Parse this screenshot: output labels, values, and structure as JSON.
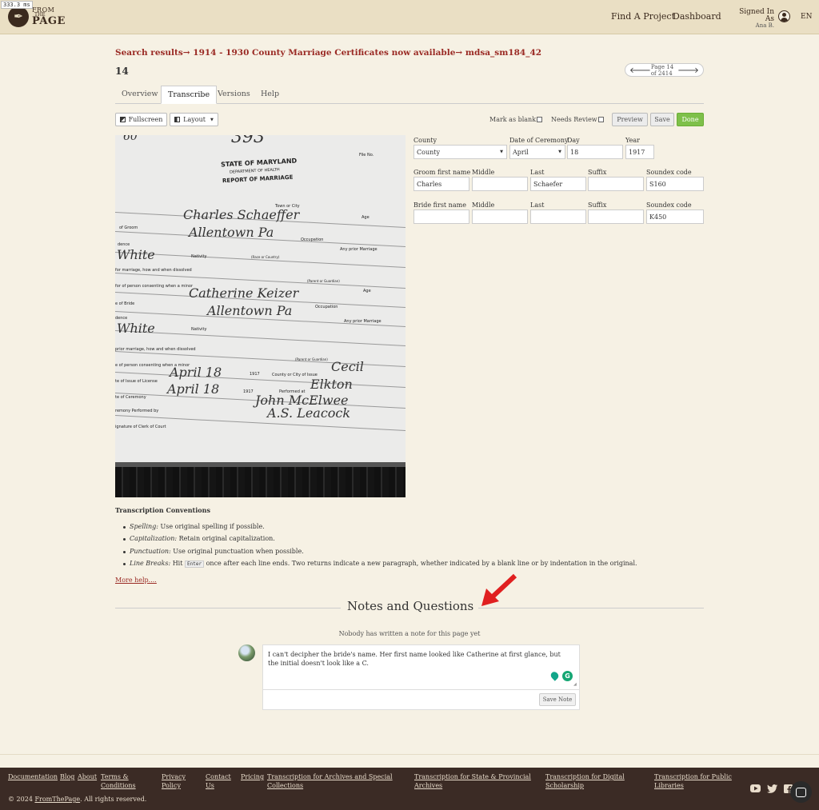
{
  "perf": "333.3 ms",
  "header": {
    "logo": {
      "line1": "FROM",
      "line2": "THE",
      "line3": "PAGE"
    },
    "nav": {
      "find_project": "Find A Project",
      "dashboard": "Dashboard"
    },
    "signed_in_as": "Signed In As",
    "user_name": "Ana B.",
    "lang": "EN"
  },
  "breadcrumb": {
    "item1": "Search results",
    "sep": "→",
    "item2": "1914 - 1930 County Marriage Certificates now available",
    "item3": "mdsa_sm184_42"
  },
  "page_title": "14",
  "pager": {
    "label": "Page 14 of 2414"
  },
  "tabs": [
    "Overview",
    "Transcribe",
    "Versions",
    "Help"
  ],
  "toolbar": {
    "fullscreen": "Fullscreen",
    "layout": "Layout",
    "mark_blank": "Mark as blank",
    "needs_review": "Needs Review",
    "preview": "Preview",
    "save": "Save",
    "done": "Done"
  },
  "document": {
    "top_number": "393",
    "top_left": "60",
    "state": "STATE OF MARYLAND",
    "dept": "DEPARTMENT OF HEALTH",
    "report": "REPORT OF MARRIAGE",
    "file_no": "File No.",
    "town": "Town or City",
    "of_groom": "of Groom",
    "age": "Age",
    "dence": "dence",
    "occupation": "Occupation",
    "nativity": "Nativity",
    "race": "(Race or Country)",
    "any_prior": "Any prior Marriage",
    "prior_how": "for marriage, how and when dissolved",
    "consent": "for of person consenting when a minor",
    "parent": "(Parent or Guardian)",
    "bride": "e of Bride",
    "prior_how2": "prior marriage, how and when dissolved",
    "consent2": "e of person consenting when a minor",
    "license": "te of Issue of License",
    "county_city": "County or City of Issue",
    "ceremony": "te of Ceremony",
    "performed_at": "Performed at",
    "performed_by": "remony Performed by",
    "clerk": "ignature of Clerk of Court",
    "hw_groom": "Charles Schaeffer",
    "hw_town1": "Allentown Pa",
    "hw_white1": "White",
    "hw_bride": "Catherine Keizer",
    "hw_town2": "Allentown Pa",
    "hw_white2": "White",
    "hw_date1": "April 18",
    "hw_yr1": "1917",
    "hw_cecil": "Cecil",
    "hw_date2": "April 18",
    "hw_yr2": "1917",
    "hw_elkton": "Elkton",
    "hw_minister": "John McElwee",
    "hw_clerk": "A.S. Leacock"
  },
  "form": {
    "county_label": "County",
    "county_value": "County",
    "date_label": "Date of Ceremony",
    "date_value": "April",
    "day_label": "Day",
    "day_value": "18",
    "year_label": "Year",
    "year_value": "1917",
    "groom_first_label": "Groom first name",
    "groom_first_value": "Charles",
    "middle_label": "Middle",
    "last_label": "Last",
    "groom_last_value": "Schaefer",
    "suffix_label": "Suffix",
    "soundex_label": "Soundex code",
    "groom_soundex_value": "S160",
    "bride_first_label": "Bride first name",
    "bride_soundex_value": "K450"
  },
  "conventions": {
    "title": "Transcription Conventions",
    "items": [
      {
        "term": "Spelling:",
        "text": " Use original spelling if possible."
      },
      {
        "term": "Capitalization:",
        "text": " Retain original capitalization."
      },
      {
        "term": "Punctuation:",
        "text": " Use original punctuation when possible."
      },
      {
        "term": "Line Breaks:",
        "text_pre": " Hit ",
        "key": "Enter",
        "text_post": " once after each line ends. Two returns indicate a new paragraph, whether indicated by a blank line or by indentation in the original."
      }
    ],
    "more_help": "More help...."
  },
  "notes": {
    "title": "Notes and Questions",
    "empty": "Nobody has written a note for this page yet",
    "draft": "I can't decipher the bride's name. Her first name looked like Catherine at first glance, but the initial doesn't look like a C.",
    "save_note": "Save Note"
  },
  "footer": {
    "documentation": "Documentation",
    "blog": "Blog",
    "about": "About",
    "terms1": "Terms &",
    "terms2": "Conditions",
    "privacy1": "Privacy",
    "privacy2": "Policy",
    "contact1": "Contact",
    "contact2": "Us",
    "pricing": "Pricing",
    "archives1": "Transcription for Archives and Special",
    "archives2": "Collections",
    "state1": "Transcription for State & Provincial",
    "state2": "Archives",
    "digital1": "Transcription for Digital",
    "digital2": "Scholarship",
    "public1": "Transcription for Public",
    "public2": "Libraries",
    "copyright_pre": "© 2024 ",
    "copyright_link": "FromThePage",
    "copyright_post": ". All rights reserved."
  },
  "colors": {
    "accent": "#9a2a24",
    "header": "#eadfc4",
    "footer": "#3b2b25",
    "done": "#7ec04a"
  }
}
